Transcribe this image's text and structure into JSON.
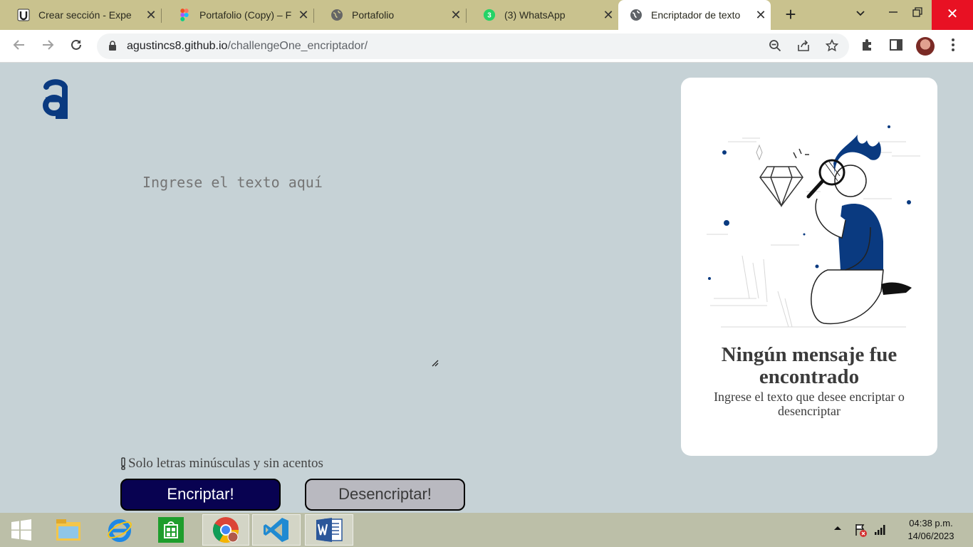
{
  "browser": {
    "tabs": [
      {
        "title": "Crear sección - Expe",
        "icon": "udemy-icon"
      },
      {
        "title": "Portafolio (Copy) – F",
        "icon": "figma-icon"
      },
      {
        "title": "Portafolio",
        "icon": "globe-icon"
      },
      {
        "title": "(3) WhatsApp",
        "icon": "whatsapp-icon",
        "badge": "3"
      },
      {
        "title": "Encriptador de texto",
        "icon": "globe-icon",
        "active": true
      }
    ],
    "new_tab": "+",
    "tab_search": "⌄",
    "url_host": "agustincs8.github.io",
    "url_path": "/challengeOne_encriptador/"
  },
  "page": {
    "logo_glyph": "a",
    "input": {
      "placeholder": "Ingrese el texto aquí",
      "value": ""
    },
    "hint": "Solo letras minúsculas y sin acentos",
    "encrypt_button": "Encriptar!",
    "decrypt_button": "Desencriptar!",
    "output": {
      "title": "Ningún mensaje fue encontrado",
      "subtitle": "Ingrese el texto que desee encriptar o desencriptar"
    }
  },
  "taskbar": {
    "apps": [
      "start-icon",
      "file-explorer-icon",
      "internet-explorer-icon",
      "store-icon",
      "chrome-icon",
      "vscode-icon",
      "word-icon"
    ],
    "time": "04:38 p.m.",
    "date": "14/06/2023"
  },
  "colors": {
    "page_bg": "#c6d2d6",
    "encrypt_bg": "#080251",
    "decrypt_bg": "#b9b9c0",
    "illustration_blue": "#0a3a80"
  }
}
